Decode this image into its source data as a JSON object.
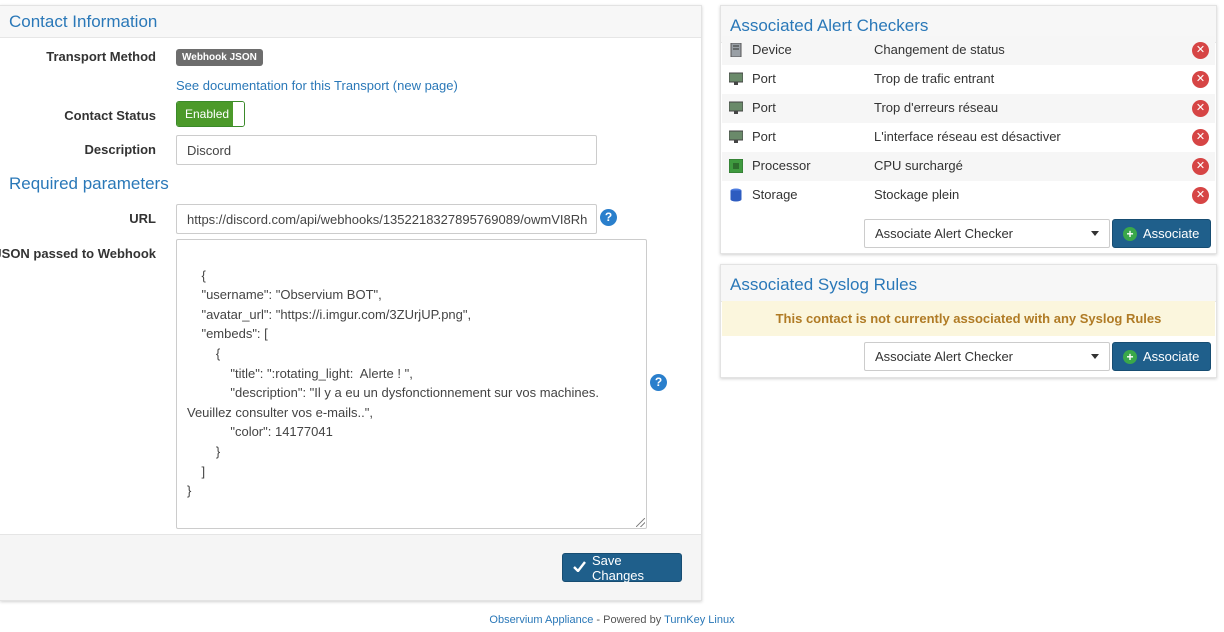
{
  "left": {
    "title": "Contact Information",
    "transport_label": "Transport Method",
    "transport_value": "Webhook JSON",
    "doc_link": "See documentation for this Transport (new page)",
    "status_label": "Contact Status",
    "status_value": "Enabled",
    "description_label": "Description",
    "description_value": "Discord",
    "required_title": "Required parameters",
    "url_label": "URL",
    "url_value": "https://discord.com/api/webhooks/1352218327895769089/owmVI8Rh",
    "json_label": "JSON passed to Webhook",
    "json_value": "{\n    \"username\": \"Observium BOT\",\n    \"avatar_url\": \"https://i.imgur.com/3ZUrjUP.png\",\n    \"embeds\": [\n        {\n            \"title\": \":rotating_light:  Alerte ! \",\n            \"description\": \"Il y a eu un dysfonctionnement sur vos machines. Veuillez consulter vos e-mails..\",\n            \"color\": 14177041\n        }\n    ]\n}",
    "save_label": "Save Changes"
  },
  "alert_checkers": {
    "title": "Associated Alert Checkers",
    "rows": [
      {
        "type": "Device",
        "name": "Changement de status",
        "icon": "device-icon"
      },
      {
        "type": "Port",
        "name": "Trop de trafic entrant",
        "icon": "port-icon"
      },
      {
        "type": "Port",
        "name": "Trop d'erreurs réseau",
        "icon": "port-icon"
      },
      {
        "type": "Port",
        "name": "L'interface réseau est désactiver",
        "icon": "port-icon"
      },
      {
        "type": "Processor",
        "name": "CPU surchargé",
        "icon": "processor-icon"
      },
      {
        "type": "Storage",
        "name": "Stockage plein",
        "icon": "storage-icon"
      }
    ],
    "select_value": "Associate Alert Checker",
    "associate_label": "Associate"
  },
  "syslog": {
    "title": "Associated Syslog Rules",
    "warning": "This contact is not currently associated with any Syslog Rules",
    "select_value": "Associate Alert Checker",
    "associate_label": "Associate"
  },
  "footer": {
    "appliance": "Observium Appliance",
    "powered": " - Powered by ",
    "turnkey": "TurnKey Linux"
  },
  "colors": {
    "accent": "#2a78b8",
    "primary_button": "#1f5f8b",
    "enabled_green": "#4c9a2a",
    "delete_red": "#d64545",
    "warning_bg": "#fbf6dd"
  }
}
